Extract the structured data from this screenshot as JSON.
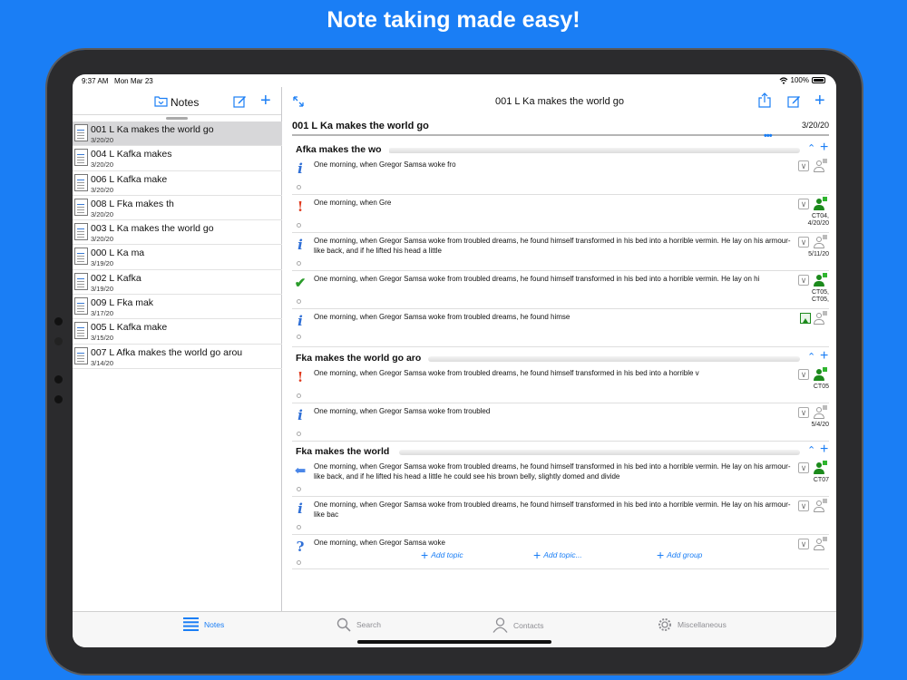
{
  "headline": "Note taking made easy!",
  "status": {
    "time": "9:37 AM",
    "date": "Mon Mar 23",
    "battery": "100%"
  },
  "left": {
    "title": "Notes",
    "notes": [
      {
        "title": "001 L Ka makes the world go",
        "date": "3/20/20",
        "selected": true
      },
      {
        "title": "004 L Kafka makes",
        "date": "3/20/20"
      },
      {
        "title": "006 L Kafka make",
        "date": "3/20/20"
      },
      {
        "title": "008 L Fka makes th",
        "date": "3/20/20"
      },
      {
        "title": "003 L Ka makes the world go",
        "date": "3/20/20"
      },
      {
        "title": "000 L Ka ma",
        "date": "3/19/20"
      },
      {
        "title": "002 L Kafka",
        "date": "3/19/20"
      },
      {
        "title": "009 L Fka mak",
        "date": "3/17/20"
      },
      {
        "title": "005 L Kafka make",
        "date": "3/15/20"
      },
      {
        "title": "007 L Afka makes the world go arou",
        "date": "3/14/20"
      }
    ]
  },
  "right": {
    "title": "001 L Ka makes the world go",
    "doc_title": "001 L Ka makes the world go",
    "doc_date": "3/20/20",
    "dots": "•••",
    "groups": [
      {
        "title": "Afka makes the wo"
      },
      {
        "title": "Fka makes the world go aro"
      },
      {
        "title": "Fka makes the world"
      }
    ],
    "topics": [
      {
        "icon": "i",
        "text": "One morning, when Gregor Samsa woke fro",
        "label": ""
      },
      {
        "icon": "!",
        "text": "One morning, when Gre",
        "label": "CT04,\n4/20/20"
      },
      {
        "icon": "i",
        "text": "One morning, when Gregor Samsa woke from troubled dreams, he found himself transformed in his bed into a horrible vermin. He lay on his armour-like back, and if he lifted his head a little",
        "label": "5/11/20"
      },
      {
        "icon": "✔",
        "text": "One morning, when Gregor Samsa woke from troubled dreams, he found himself transformed in his bed into a horrible vermin. He lay on hi",
        "label": "CT05,\nCT05,"
      },
      {
        "icon": "i",
        "text": "One morning, when Gregor Samsa woke from troubled dreams, he found himse",
        "label": ""
      },
      {
        "icon": "!",
        "text": "One morning, when Gregor Samsa woke from troubled dreams, he found himself transformed in his bed into a horrible v",
        "label": "CT05"
      },
      {
        "icon": "i",
        "text": "One morning, when Gregor Samsa woke from troubled",
        "label": "5/4/20"
      },
      {
        "icon": "⬅",
        "text": "One morning, when Gregor Samsa woke from troubled dreams, he found himself transformed in his bed into a horrible vermin. He lay on his armour-like back, and if he lifted his head a little he could see his brown belly, slightly domed and divide",
        "label": "CT07"
      },
      {
        "icon": "i",
        "text": "One morning, when Gregor Samsa woke from troubled dreams, he found himself transformed in his bed into a horrible vermin. He lay on his armour-like bac",
        "label": ""
      },
      {
        "icon": "?",
        "text": "One morning, when Gregor Samsa woke",
        "label": ""
      }
    ],
    "add_topic": "Add topic",
    "add_topic_more": "Add topic...",
    "add_group": "Add group"
  },
  "tabs": [
    {
      "label": "Notes",
      "icon": "notes-list-icon",
      "active": true
    },
    {
      "label": "Search",
      "icon": "search-icon"
    },
    {
      "label": "Contacts",
      "icon": "person-icon"
    },
    {
      "label": "Miscellaneous",
      "icon": "gear-icon"
    }
  ],
  "colors": {
    "background": "#1a7ef5",
    "accent": "#1a7ef5",
    "green": "#1c8a1c",
    "red": "#e03a1e"
  }
}
